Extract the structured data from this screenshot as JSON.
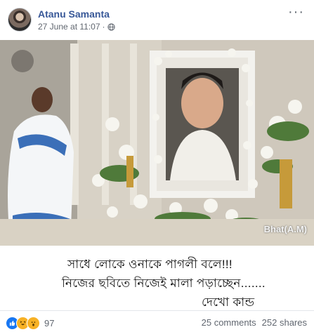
{
  "post": {
    "author": "Atanu Samanta",
    "date": "27 June at 11:07",
    "separator": "·",
    "more_label": "···"
  },
  "image": {
    "watermark": "Bhat(A.M)",
    "caption_lines": [
      "সাধে লোকে ওনাকে পাগলী বলে!!!",
      "নিজের ছবিতে নিজেই মালা পড়াচ্ছেন.......",
      "দেখো কান্ড"
    ]
  },
  "footer": {
    "reaction_count": "97",
    "comments": "25 comments",
    "shares": "252 shares"
  },
  "icons": [
    "globe-icon",
    "like-icon",
    "haha-icon",
    "wow-icon"
  ],
  "colors": {
    "author": "#385898",
    "meta": "#616770",
    "like": "#1877f2",
    "reaction": "#f7b125"
  }
}
